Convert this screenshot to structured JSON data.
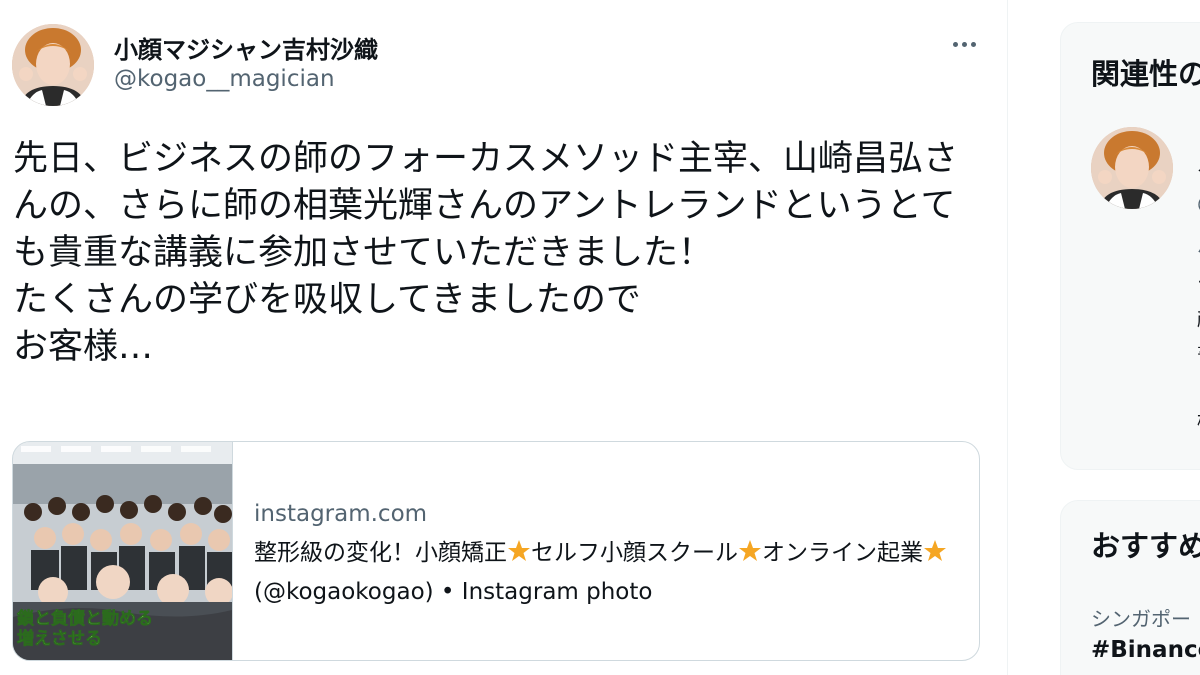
{
  "tweet": {
    "display_name": "小顔マジシャン吉村沙織",
    "handle": "@kogao__magician",
    "text": "先日、ビジネスの師のフォーカスメソッド主宰、山崎昌弘さんの、さらに師の相葉光輝さんのアントレランドというとても貴重な講義に参加させていただきました！\nたくさんの学びを吸収してきましたので\nお客様…",
    "card": {
      "domain": "instagram.com",
      "title_part1": "整形級の変化！小顔矯正",
      "title_part2": "セルフ小顔スクール",
      "title_part3": "オンライン起業",
      "title_part4": " (@kogaokogao) • Instagram photo",
      "thumb_caption_1": "鎖と負債と動める",
      "thumb_caption_2": "増えさせる"
    }
  },
  "sidebar": {
    "relevant": {
      "title": "関連性の",
      "cut_lines": [
        "ク",
        "@",
        "パ",
        "+",
        "顔",
        "書",
        "日",
        "椎"
      ]
    },
    "recommended": {
      "title": "おすすめ",
      "trend_meta": "シンガポー",
      "trend_name": "#Binance"
    }
  },
  "colors": {
    "text": "#0f1419",
    "muted": "#536471",
    "border": "#cfd9de",
    "star": "#f5a623"
  },
  "icons": [
    "more-icon",
    "star-icon",
    "avatar-image"
  ]
}
